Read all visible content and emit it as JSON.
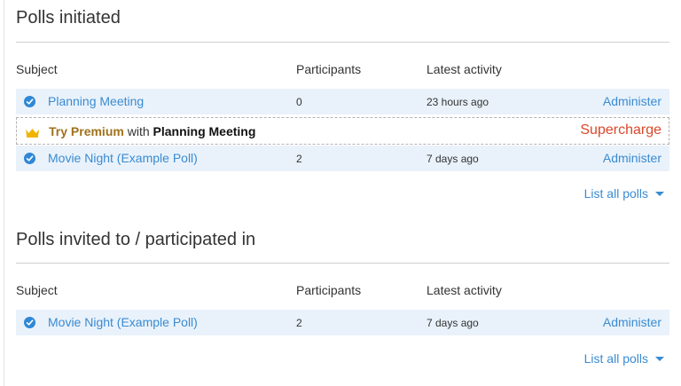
{
  "initiated": {
    "title": "Polls initiated",
    "headers": {
      "subject": "Subject",
      "participants": "Participants",
      "activity": "Latest activity"
    },
    "rows": [
      {
        "subject": "Planning Meeting",
        "participants": "0",
        "activity": "23 hours ago",
        "action": "Administer"
      },
      {
        "subject": "Movie Night (Example Poll)",
        "participants": "2",
        "activity": "7 days ago",
        "action": "Administer"
      }
    ],
    "premium": {
      "try": "Try Premium",
      "with": "with",
      "poll": "Planning Meeting",
      "action": "Supercharge"
    },
    "list_all": "List all polls"
  },
  "invited": {
    "title": "Polls invited to / participated in",
    "headers": {
      "subject": "Subject",
      "participants": "Participants",
      "activity": "Latest activity"
    },
    "rows": [
      {
        "subject": "Movie Night (Example Poll)",
        "participants": "2",
        "activity": "7 days ago",
        "action": "Administer"
      }
    ],
    "list_all": "List all polls"
  },
  "icons": {
    "row_status": "check-circle-icon",
    "premium": "crown-icon",
    "list_all": "caret-down-icon"
  },
  "colors": {
    "link": "#3a8bd1",
    "row_bg": "#e9f2fb",
    "premium_text": "#a1711b",
    "supercharge": "#d8482a",
    "crown": "#f0b400"
  }
}
